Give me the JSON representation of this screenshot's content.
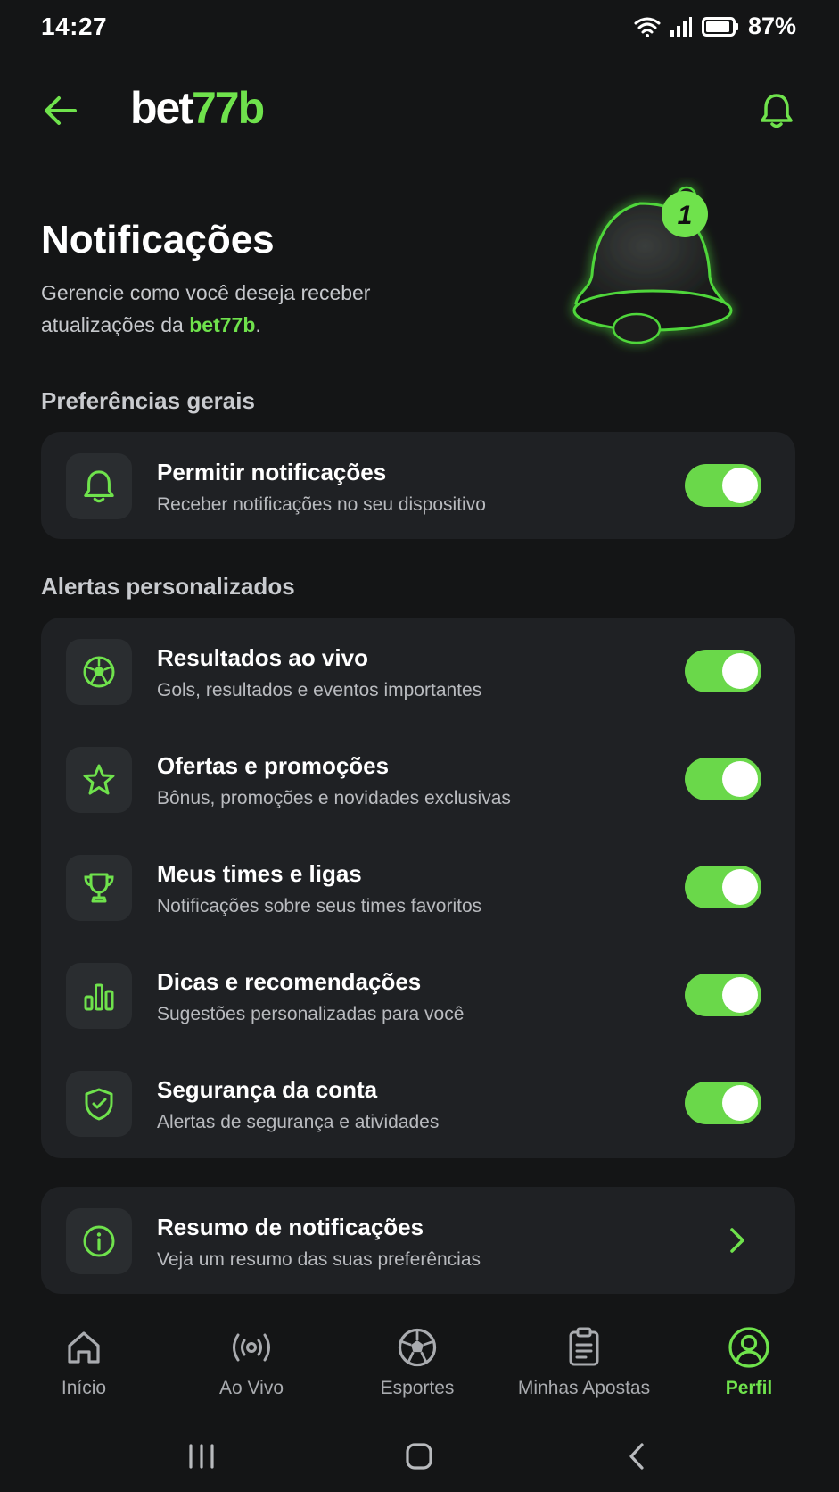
{
  "status_bar": {
    "time": "14:27",
    "battery": "87%"
  },
  "header": {
    "logo_main": "bet",
    "logo_accent": "77b"
  },
  "hero": {
    "title": "Notificações",
    "subtitle_part1": "Gerencie como você deseja receber atualizações da ",
    "subtitle_brand": "bet77b",
    "subtitle_end": ".",
    "badge_count": "1"
  },
  "sections": {
    "general_label": "Preferências gerais",
    "custom_label": "Alertas personalizados"
  },
  "general": {
    "title": "Permitir notificações",
    "desc": "Receber notificações no seu dispositivo",
    "icon": "bell-icon",
    "enabled": true
  },
  "alerts": [
    {
      "title": "Resultados ao vivo",
      "desc": "Gols, resultados e eventos importantes",
      "icon": "soccer-ball-icon",
      "enabled": true
    },
    {
      "title": "Ofertas e promoções",
      "desc": "Bônus, promoções e novidades exclusivas",
      "icon": "star-icon",
      "enabled": true
    },
    {
      "title": "Meus times e ligas",
      "desc": "Notificações sobre seus times favoritos",
      "icon": "trophy-icon",
      "enabled": true
    },
    {
      "title": "Dicas e recomendações",
      "desc": "Sugestões personalizadas para você",
      "icon": "bar-chart-icon",
      "enabled": true
    },
    {
      "title": "Segurança da conta",
      "desc": "Alertas de segurança e atividades",
      "icon": "shield-icon",
      "enabled": true
    }
  ],
  "summary": {
    "title": "Resumo de notificações",
    "desc": "Veja um resumo das suas preferências",
    "icon": "info-icon"
  },
  "nav": [
    {
      "label": "Início",
      "icon": "home-icon",
      "active": false
    },
    {
      "label": "Ao Vivo",
      "icon": "live-broadcast-icon",
      "active": false
    },
    {
      "label": "Esportes",
      "icon": "soccer-ball-icon",
      "active": false
    },
    {
      "label": "Minhas Apostas",
      "icon": "clipboard-icon",
      "active": false
    },
    {
      "label": "Perfil",
      "icon": "profile-icon",
      "active": true
    }
  ],
  "colors": {
    "accent": "#6fe24c",
    "background": "#141516",
    "card": "#1f2124",
    "toggle_on": "#6ad84a"
  }
}
